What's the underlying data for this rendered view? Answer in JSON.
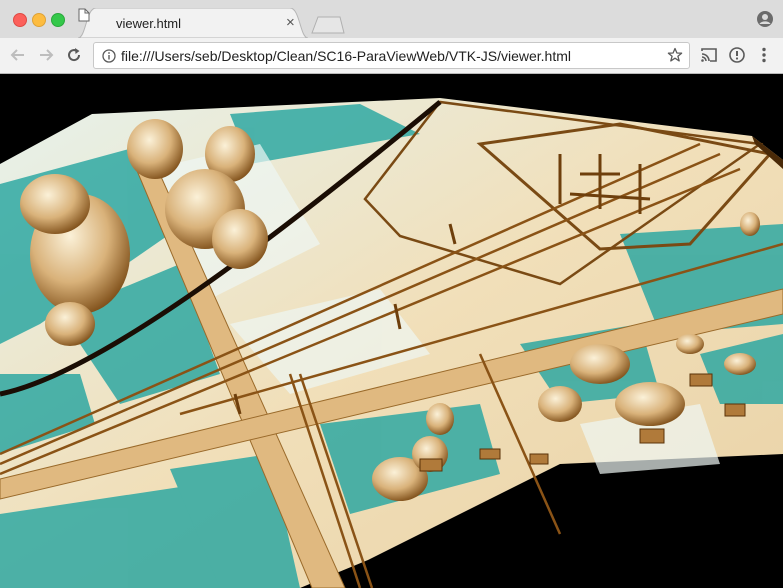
{
  "browser": {
    "tab": {
      "title": "viewer.html",
      "icon": "document-icon",
      "close": "×"
    },
    "address_bar": {
      "url": "file:///Users/seb/Desktop/Clean/SC16-ParaViewWeb/VTK-JS/viewer.html"
    },
    "nav": {
      "back": "back-arrow-icon",
      "forward": "forward-arrow-icon",
      "reload": "reload-icon"
    },
    "toolbar_icons": [
      "star-icon",
      "cast-icon",
      "info-icon",
      "menu-dots-icon"
    ]
  },
  "viewer": {
    "background": "#000000",
    "colors": {
      "low": "#1a9a94",
      "mid": "#e8f4ef",
      "high": "#f3deb4",
      "top": "#8a5316"
    }
  }
}
